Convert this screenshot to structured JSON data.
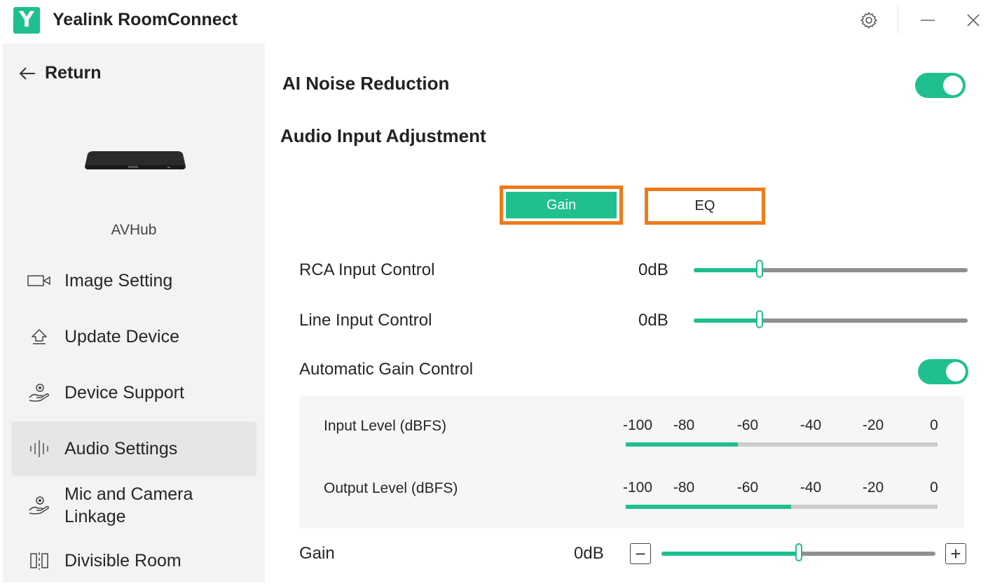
{
  "app": {
    "logo_letter": "Y",
    "title": "Yealink RoomConnect"
  },
  "window_controls": {
    "settings_icon": "gear-icon",
    "minimize_icon": "minimize-icon",
    "close_icon": "close-icon"
  },
  "sidebar": {
    "return_label": "Return",
    "device_name": "AVHub",
    "items": [
      {
        "label": "Image Setting",
        "icon": "camera-icon",
        "active": false
      },
      {
        "label": "Update Device",
        "icon": "upload-icon",
        "active": false
      },
      {
        "label": "Device Support",
        "icon": "support-hand-icon",
        "active": false
      },
      {
        "label": "Audio Settings",
        "icon": "audio-wave-icon",
        "active": true
      },
      {
        "label": "Mic and Camera Linkage",
        "icon": "linkage-hand-icon",
        "active": false
      },
      {
        "label": "Divisible Room",
        "icon": "divisible-room-icon",
        "active": false
      }
    ]
  },
  "main": {
    "ai_noise_reduction": {
      "label": "AI Noise Reduction",
      "enabled": true
    },
    "audio_input_title": "Audio Input Adjustment",
    "tabs": [
      {
        "label": "Gain",
        "selected": true
      },
      {
        "label": "EQ",
        "selected": false
      }
    ],
    "rca_input": {
      "label": "RCA Input Control",
      "value": "0dB",
      "level": 0.24
    },
    "line_input": {
      "label": "Line Input Control",
      "value": "0dB",
      "level": 0.24
    },
    "agc": {
      "label": "Automatic Gain Control",
      "enabled": true
    },
    "input_level": {
      "label": "Input Level (dBFS)",
      "ticks": [
        "-100",
        "-80",
        "-60",
        "-40",
        "-20",
        "0"
      ],
      "level_dbfs": -64
    },
    "output_level": {
      "label": "Output Level (dBFS)",
      "ticks": [
        "-100",
        "-80",
        "-60",
        "-40",
        "-20",
        "0"
      ],
      "level_dbfs": -47
    },
    "gain": {
      "label": "Gain",
      "value": "0dB",
      "level": 0.5,
      "decrease_symbol": "−",
      "increase_symbol": "+"
    }
  },
  "colors": {
    "accent": "#1fbf8f",
    "highlight_frame": "#f07a1a",
    "sidebar_bg": "#f3f3f3"
  }
}
